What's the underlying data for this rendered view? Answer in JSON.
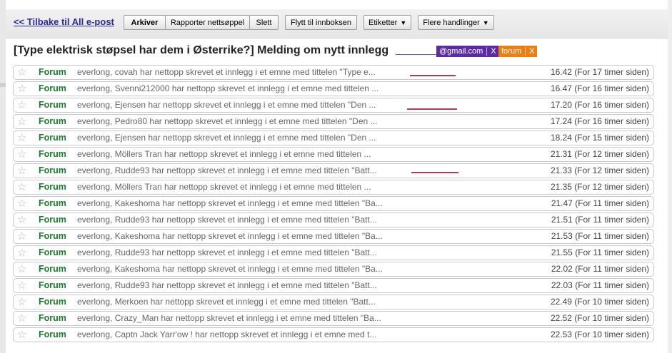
{
  "toolbar": {
    "back_label": "<< Tilbake til All e-post",
    "archive": "Arkiver",
    "report_spam": "Rapporter nettsøppel",
    "delete": "Slett",
    "move_inbox": "Flytt til innboksen",
    "labels": "Etiketter",
    "more_actions": "Flere handlinger"
  },
  "thread": {
    "subject": "[Type elektrisk støpsel har dem i Østerrike?] Melding om nytt innlegg",
    "email_label": "@gmail.com",
    "forum_label": "forum",
    "remove_glyph": "X"
  },
  "colors": {
    "sender": "#1c7a2c",
    "email_label": "#5b2ca0",
    "forum_label": "#e87f17",
    "link": "#2a2a9c"
  },
  "messages": [
    {
      "sender": "Forum",
      "snippet": "everlong, covah har nettopp skrevet et innlegg i et emne med tittelen \"Type e...",
      "time": "16.42 (For 17 timer siden)"
    },
    {
      "sender": "Forum",
      "snippet": "everlong, Svenni212000 har nettopp skrevet et innlegg i et emne med tittelen ...",
      "time": "16.47 (For 16 timer siden)"
    },
    {
      "sender": "Forum",
      "snippet": "everlong, Ejensen har nettopp skrevet et innlegg i et emne med tittelen \"Den ...",
      "time": "17.20 (For 16 timer siden)"
    },
    {
      "sender": "Forum",
      "snippet": "everlong, Pedro80 har nettopp skrevet et innlegg i et emne med tittelen \"Den ...",
      "time": "17.24 (For 16 timer siden)"
    },
    {
      "sender": "Forum",
      "snippet": "everlong, Ejensen har nettopp skrevet et innlegg i et emne med tittelen \"Den ...",
      "time": "18.24 (For 15 timer siden)"
    },
    {
      "sender": "Forum",
      "snippet": "everlong, Möllers Tran har nettopp skrevet et innlegg i et emne med tittelen ...",
      "time": "21.31 (For 12 timer siden)"
    },
    {
      "sender": "Forum",
      "snippet": "everlong, Rudde93 har nettopp skrevet et innlegg i et emne med tittelen \"Batt...",
      "time": "21.33 (For 12 timer siden)"
    },
    {
      "sender": "Forum",
      "snippet": "everlong, Möllers Tran har nettopp skrevet et innlegg i et emne med tittelen ...",
      "time": "21.35 (For 12 timer siden)"
    },
    {
      "sender": "Forum",
      "snippet": "everlong, Kakeshoma har nettopp skrevet et innlegg i et emne med tittelen \"Ba...",
      "time": "21.47 (For 11 timer siden)"
    },
    {
      "sender": "Forum",
      "snippet": "everlong, Rudde93 har nettopp skrevet et innlegg i et emne med tittelen \"Batt...",
      "time": "21.51 (For 11 timer siden)"
    },
    {
      "sender": "Forum",
      "snippet": "everlong, Kakeshoma har nettopp skrevet et innlegg i et emne med tittelen \"Ba...",
      "time": "21.53 (For 11 timer siden)"
    },
    {
      "sender": "Forum",
      "snippet": "everlong, Rudde93 har nettopp skrevet et innlegg i et emne med tittelen \"Batt...",
      "time": "21.55 (For 11 timer siden)"
    },
    {
      "sender": "Forum",
      "snippet": "everlong, Kakeshoma har nettopp skrevet et innlegg i et emne med tittelen \"Ba...",
      "time": "22.02 (For 11 timer siden)"
    },
    {
      "sender": "Forum",
      "snippet": "everlong, Rudde93 har nettopp skrevet et innlegg i et emne med tittelen \"Batt...",
      "time": "22.03 (For 11 timer siden)"
    },
    {
      "sender": "Forum",
      "snippet": "everlong, Merkoen har nettopp skrevet et innlegg i et emne med tittelen \"Batt...",
      "time": "22.49 (For 10 timer siden)"
    },
    {
      "sender": "Forum",
      "snippet": "everlong, Crazy_Man har nettopp skrevet et innlegg i et emne med tittelen \"Ba...",
      "time": "22.52 (For 10 timer siden)"
    },
    {
      "sender": "Forum",
      "snippet": "everlong, Captn Jack Yarr'ow ! har nettopp skrevet et innlegg i et emne med t...",
      "time": "22.53 (For 10 timer siden)"
    }
  ]
}
